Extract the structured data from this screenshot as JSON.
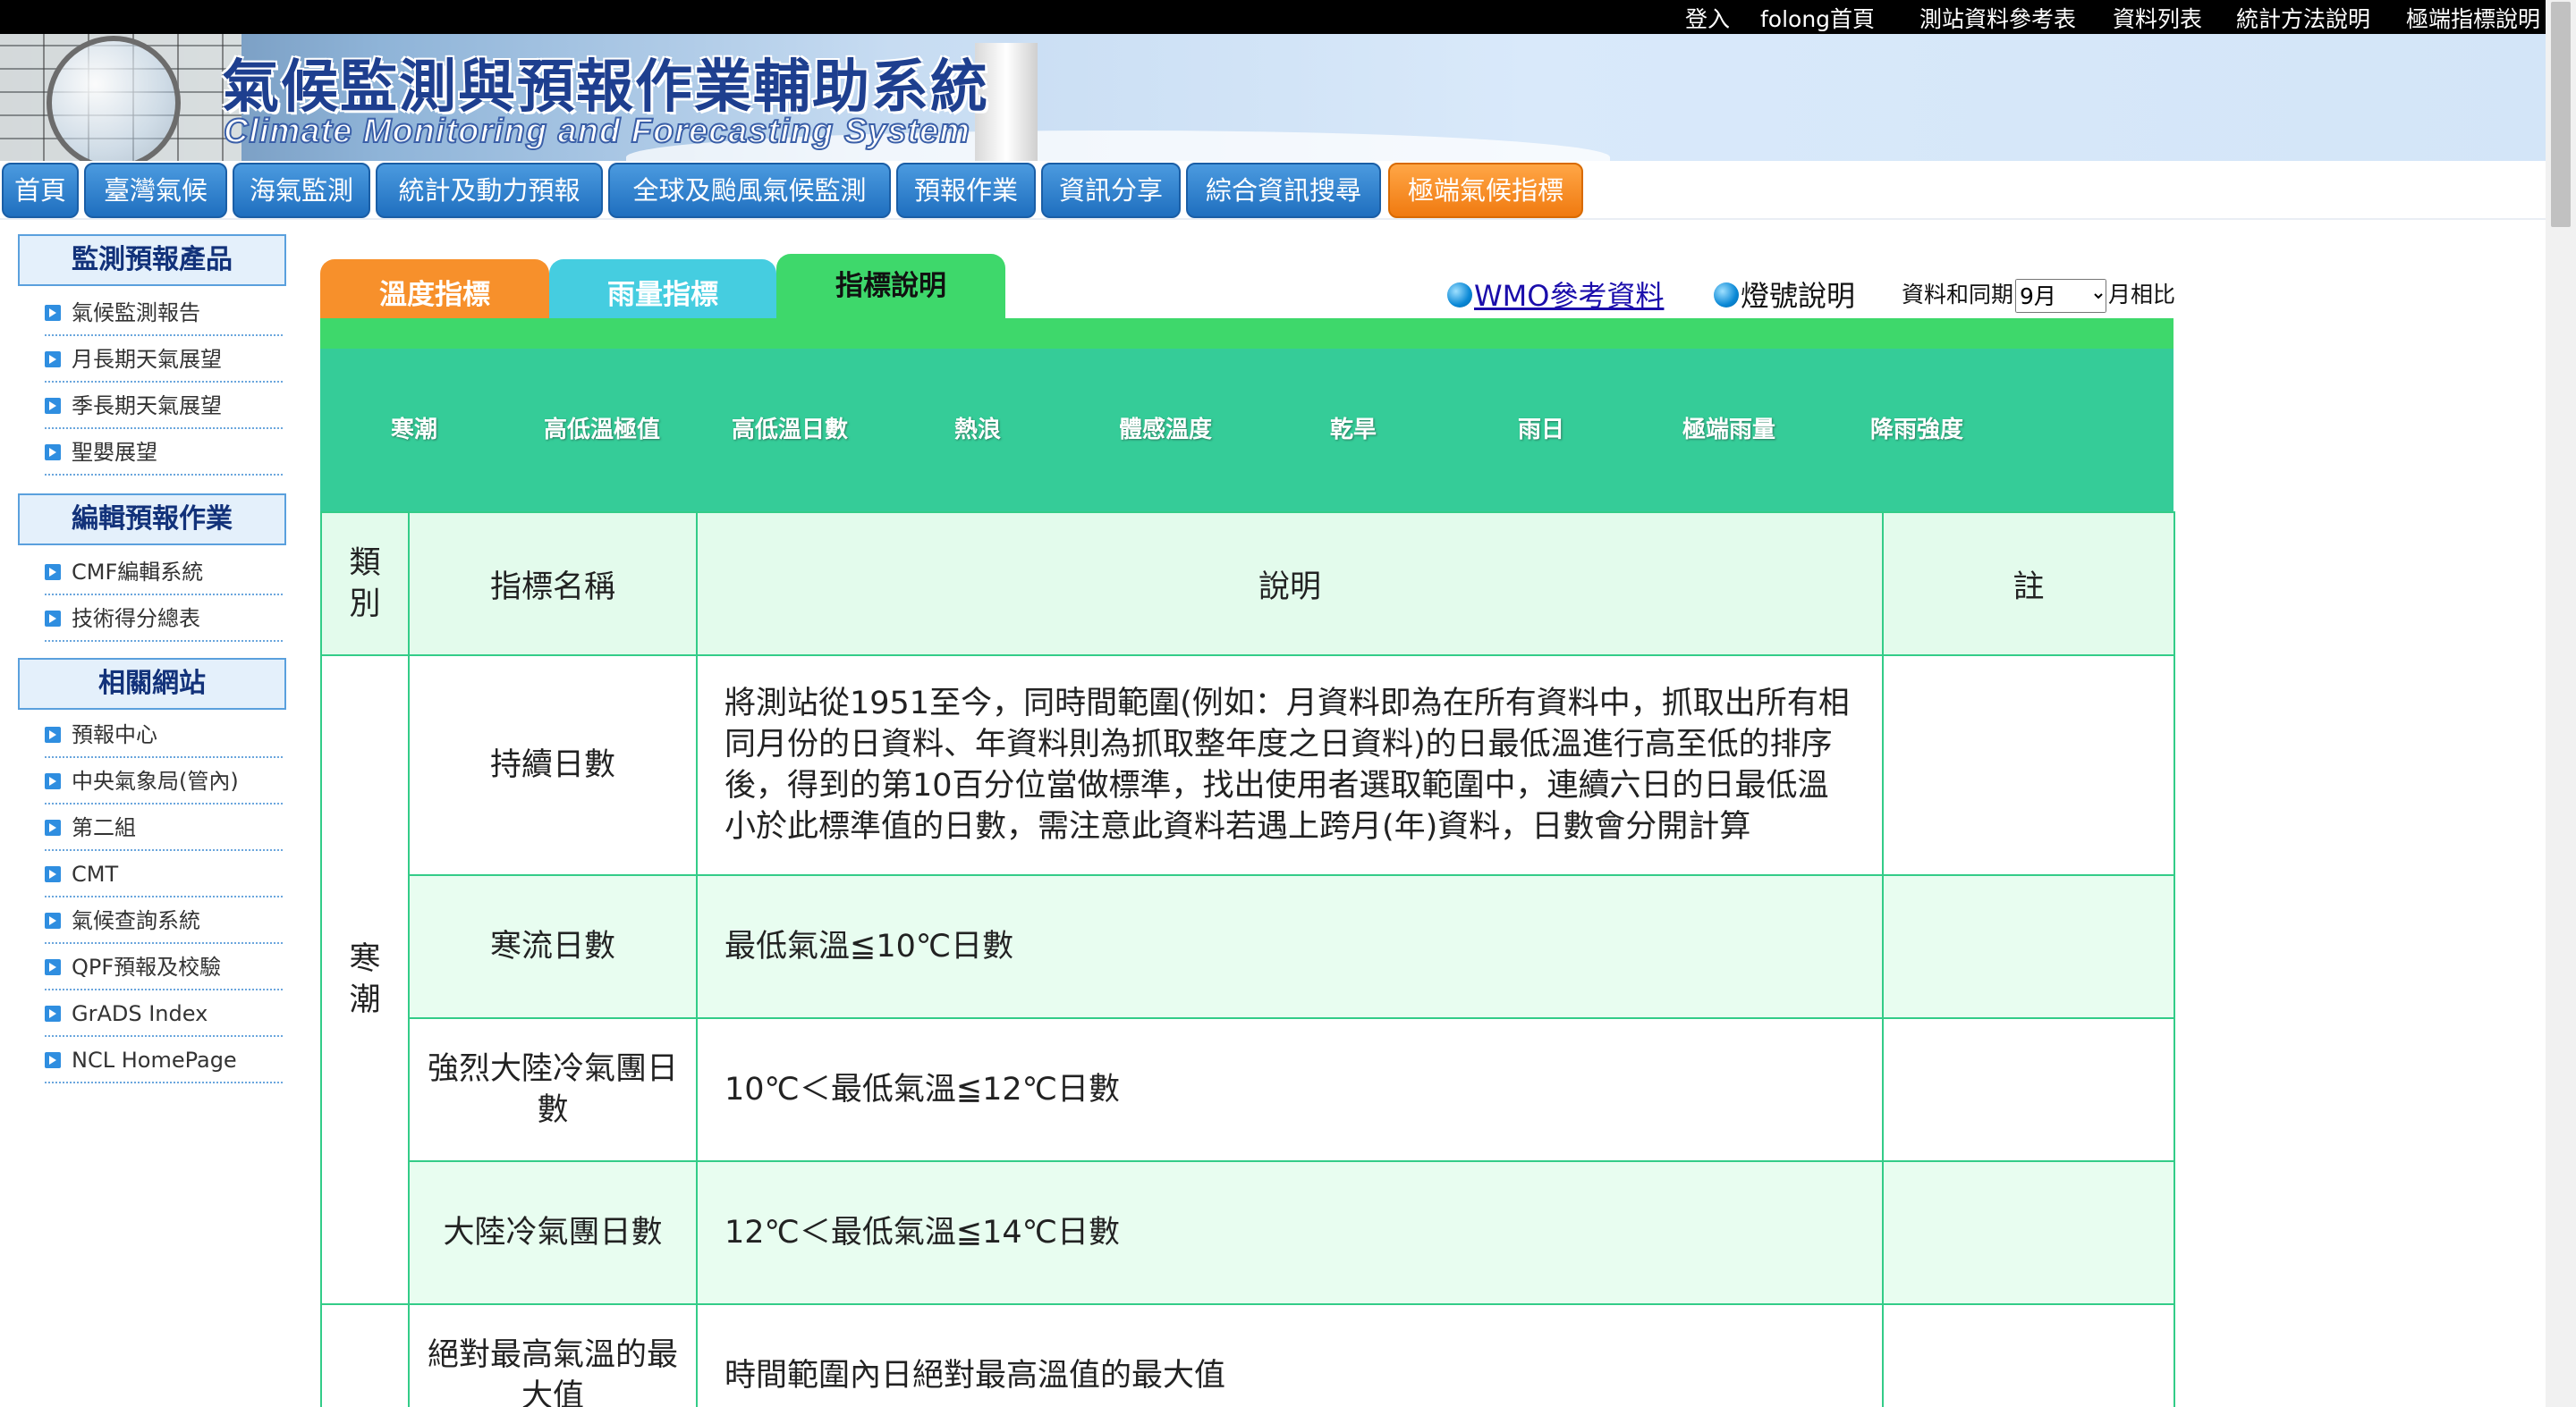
{
  "topbar": {
    "links": [
      "登入",
      "folong首頁",
      "測站資料參考表",
      "資料列表",
      "統計方法說明",
      "極端指標說明"
    ]
  },
  "banner": {
    "title_zh": "氣候監測與預報作業輔助系統",
    "title_en": "Climate Monitoring and Forecasting System"
  },
  "nav": {
    "items": [
      "首頁",
      "臺灣氣候",
      "海氣監測",
      "統計及動力預報",
      "全球及颱風氣候監測",
      "預報作業",
      "資訊分享",
      "綜合資訊搜尋",
      "極端氣候指標"
    ],
    "active_color": "#f07a10",
    "color": "#1f6fbf"
  },
  "sidebar": {
    "sections": [
      {
        "title": "監測預報產品",
        "items": [
          "氣候監測報告",
          "月長期天氣展望",
          "季長期天氣展望",
          "聖嬰展望"
        ]
      },
      {
        "title": "編輯預報作業",
        "items": [
          "CMF編輯系統",
          "技術得分總表"
        ]
      },
      {
        "title": "相關網站",
        "items": [
          "預報中心",
          "中央氣象局(管內)",
          "第二組",
          "CMT",
          "氣候查詢系統",
          "QPF預報及校驗",
          "GrADS Index",
          "NCL HomePage"
        ]
      }
    ]
  },
  "tabs": {
    "temperature": "溫度指標",
    "rain": "雨量指標",
    "description": "指標說明"
  },
  "links": {
    "wmo": "WMO參考資料",
    "lamp": "燈號說明"
  },
  "period": {
    "prefix": "資料和同期",
    "selected": "9月",
    "suffix": "月相比"
  },
  "indices": [
    "寒潮",
    "高低溫極值",
    "高低溫日數",
    "熱浪",
    "體感溫度",
    "乾旱",
    "雨日",
    "極端雨量",
    "降雨強度"
  ],
  "table": {
    "headers": {
      "category": "類別",
      "name": "指標名稱",
      "description": "說明",
      "note": "註"
    },
    "category_cold": "寒潮",
    "rows": [
      {
        "name": "持續日數",
        "description": "將測站從1951至今，同時間範圍(例如：月資料即為在所有資料中，抓取出所有相同月份的日資料、年資料則為抓取整年度之日資料)的日最低溫進行高至低的排序後，得到的第10百分位當做標準，找出使用者選取範圍中，連續六日的日最低溫小於此標準值的日數，需注意此資料若遇上跨月(年)資料，日數會分開計算",
        "note": ""
      },
      {
        "name": "寒流日數",
        "description": "最低氣溫≦10℃日數",
        "note": ""
      },
      {
        "name": "強烈大陸冷氣團日數",
        "description": "10℃＜最低氣溫≦12℃日數",
        "note": ""
      },
      {
        "name": "大陸冷氣團日數",
        "description": "12℃＜最低氣溫≦14℃日數",
        "note": ""
      },
      {
        "name": "絕對最高氣溫的最大值",
        "description": "時間範圍內日絕對最高溫值的最大值",
        "note": ""
      }
    ]
  },
  "colors": {
    "tab_temperature": "#f7902b",
    "tab_rain": "#45cde0",
    "tab_description": "#3ed86b",
    "band": "#35cc98"
  }
}
